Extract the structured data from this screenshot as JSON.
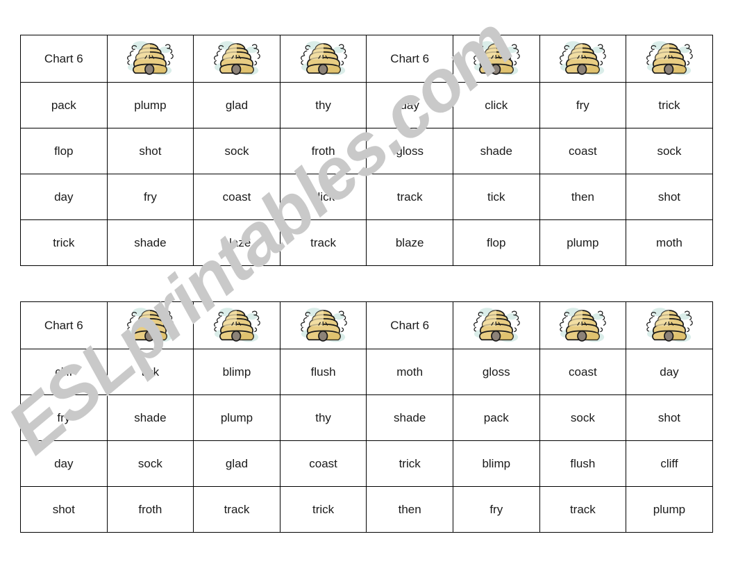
{
  "document": {
    "title": "Chart 6",
    "watermark": "ESLprintables.com",
    "background_color": "#ffffff",
    "border_color": "#000000",
    "text_color": "#1a1a1a",
    "watermark_color": "#c9c9c9"
  },
  "icons": {
    "beehive": {
      "name": "beehive-icon",
      "hive_light": "#f5e3ae",
      "hive_mid": "#e8cd83",
      "hive_dark": "#d9b95f",
      "outline": "#1a1a1a",
      "entrance": "#8c8278",
      "wash": "#bde0d8"
    }
  },
  "tables": [
    {
      "name": "bingo-card-1",
      "columns": 8,
      "rows": [
        {
          "type": "header",
          "cells": [
            {
              "kind": "text",
              "value": "Chart 6"
            },
            {
              "kind": "icon",
              "value": "beehive"
            },
            {
              "kind": "icon",
              "value": "beehive"
            },
            {
              "kind": "icon",
              "value": "beehive"
            },
            {
              "kind": "text",
              "value": "Chart 6"
            },
            {
              "kind": "icon",
              "value": "beehive"
            },
            {
              "kind": "icon",
              "value": "beehive"
            },
            {
              "kind": "icon",
              "value": "beehive"
            }
          ]
        },
        {
          "type": "words",
          "cells": [
            {
              "kind": "text",
              "value": "pack"
            },
            {
              "kind": "text",
              "value": "plump"
            },
            {
              "kind": "text",
              "value": "glad"
            },
            {
              "kind": "text",
              "value": "thy"
            },
            {
              "kind": "text",
              "value": "day"
            },
            {
              "kind": "text",
              "value": "click"
            },
            {
              "kind": "text",
              "value": "fry"
            },
            {
              "kind": "text",
              "value": "trick"
            }
          ]
        },
        {
          "type": "words",
          "cells": [
            {
              "kind": "text",
              "value": "flop"
            },
            {
              "kind": "text",
              "value": "shot"
            },
            {
              "kind": "text",
              "value": "sock"
            },
            {
              "kind": "text",
              "value": "froth"
            },
            {
              "kind": "text",
              "value": "gloss"
            },
            {
              "kind": "text",
              "value": "shade"
            },
            {
              "kind": "text",
              "value": "coast"
            },
            {
              "kind": "text",
              "value": "sock"
            }
          ]
        },
        {
          "type": "words",
          "cells": [
            {
              "kind": "text",
              "value": "day"
            },
            {
              "kind": "text",
              "value": "fry"
            },
            {
              "kind": "text",
              "value": "coast"
            },
            {
              "kind": "text",
              "value": "click"
            },
            {
              "kind": "text",
              "value": "track"
            },
            {
              "kind": "text",
              "value": "tick"
            },
            {
              "kind": "text",
              "value": "then"
            },
            {
              "kind": "text",
              "value": "shot"
            }
          ]
        },
        {
          "type": "words",
          "cells": [
            {
              "kind": "text",
              "value": "trick"
            },
            {
              "kind": "text",
              "value": "shade"
            },
            {
              "kind": "text",
              "value": "blaze"
            },
            {
              "kind": "text",
              "value": "track"
            },
            {
              "kind": "text",
              "value": "blaze"
            },
            {
              "kind": "text",
              "value": "flop"
            },
            {
              "kind": "text",
              "value": "plump"
            },
            {
              "kind": "text",
              "value": "moth"
            }
          ]
        }
      ]
    },
    {
      "name": "bingo-card-2",
      "columns": 8,
      "rows": [
        {
          "type": "header",
          "cells": [
            {
              "kind": "text",
              "value": "Chart 6"
            },
            {
              "kind": "icon",
              "value": "beehive"
            },
            {
              "kind": "icon",
              "value": "beehive"
            },
            {
              "kind": "icon",
              "value": "beehive"
            },
            {
              "kind": "text",
              "value": "Chart 6"
            },
            {
              "kind": "icon",
              "value": "beehive"
            },
            {
              "kind": "icon",
              "value": "beehive"
            },
            {
              "kind": "icon",
              "value": "beehive"
            }
          ]
        },
        {
          "type": "words",
          "cells": [
            {
              "kind": "text",
              "value": "cliff"
            },
            {
              "kind": "text",
              "value": "tick"
            },
            {
              "kind": "text",
              "value": "blimp"
            },
            {
              "kind": "text",
              "value": "flush"
            },
            {
              "kind": "text",
              "value": "moth"
            },
            {
              "kind": "text",
              "value": "gloss"
            },
            {
              "kind": "text",
              "value": "coast"
            },
            {
              "kind": "text",
              "value": "day"
            }
          ]
        },
        {
          "type": "words",
          "cells": [
            {
              "kind": "text",
              "value": "fry"
            },
            {
              "kind": "text",
              "value": "shade"
            },
            {
              "kind": "text",
              "value": "plump"
            },
            {
              "kind": "text",
              "value": "thy"
            },
            {
              "kind": "text",
              "value": "shade"
            },
            {
              "kind": "text",
              "value": "pack"
            },
            {
              "kind": "text",
              "value": "sock"
            },
            {
              "kind": "text",
              "value": "shot"
            }
          ]
        },
        {
          "type": "words",
          "cells": [
            {
              "kind": "text",
              "value": "day"
            },
            {
              "kind": "text",
              "value": "sock"
            },
            {
              "kind": "text",
              "value": "glad"
            },
            {
              "kind": "text",
              "value": "coast"
            },
            {
              "kind": "text",
              "value": "trick"
            },
            {
              "kind": "text",
              "value": "blimp"
            },
            {
              "kind": "text",
              "value": "flush"
            },
            {
              "kind": "text",
              "value": "cliff"
            }
          ]
        },
        {
          "type": "words",
          "cells": [
            {
              "kind": "text",
              "value": "shot"
            },
            {
              "kind": "text",
              "value": "froth"
            },
            {
              "kind": "text",
              "value": "track"
            },
            {
              "kind": "text",
              "value": "trick"
            },
            {
              "kind": "text",
              "value": "then"
            },
            {
              "kind": "text",
              "value": "fry"
            },
            {
              "kind": "text",
              "value": "track"
            },
            {
              "kind": "text",
              "value": "plump"
            }
          ]
        }
      ]
    }
  ]
}
